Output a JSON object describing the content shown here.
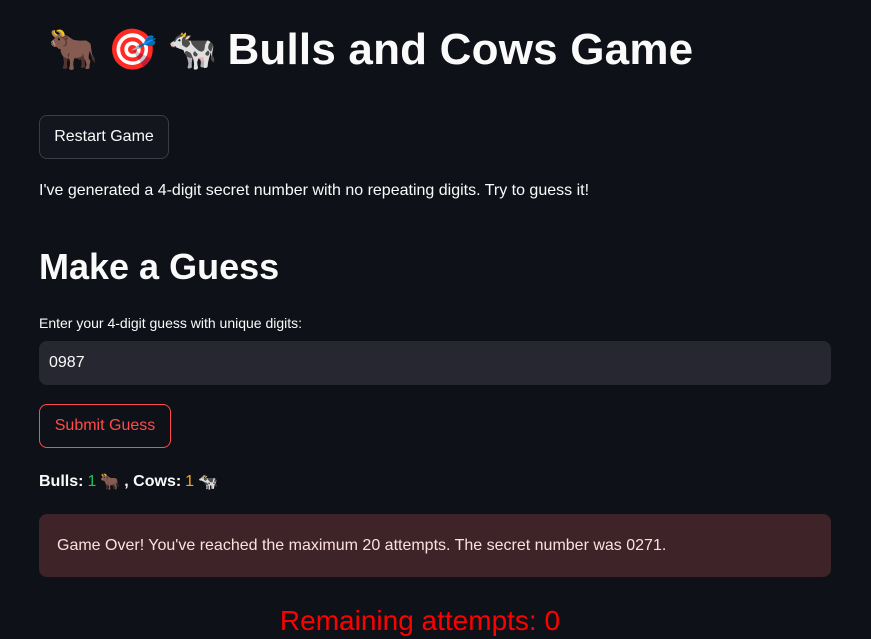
{
  "header": {
    "emoji_1": "🐂",
    "emoji_2": "🎯",
    "emoji_3": "🐄",
    "title": "Bulls and Cows Game"
  },
  "restart_label": "Restart Game",
  "intro_text": "I've generated a 4-digit secret number with no repeating digits. Try to guess it!",
  "section_heading": "Make a Guess",
  "input": {
    "label": "Enter your 4-digit guess with unique digits:",
    "value": "0987"
  },
  "submit_label": "Submit Guess",
  "result": {
    "bulls_label": "Bulls:",
    "bulls_value": "1",
    "bull_emoji": "🐂",
    "cows_label": ", Cows:",
    "cows_value": "1",
    "cow_emoji": "🐄"
  },
  "alert_text": "Game Over! You've reached the maximum 20 attempts. The secret number was 0271.",
  "remaining_text": "Remaining attempts: 0",
  "colors": {
    "background": "#0e1117",
    "accent_red": "#ff4b4b",
    "bulls_green": "#21c354",
    "cows_orange": "#ffa421",
    "remaining_red": "#ff0000",
    "alert_bg": "#3e2428"
  }
}
